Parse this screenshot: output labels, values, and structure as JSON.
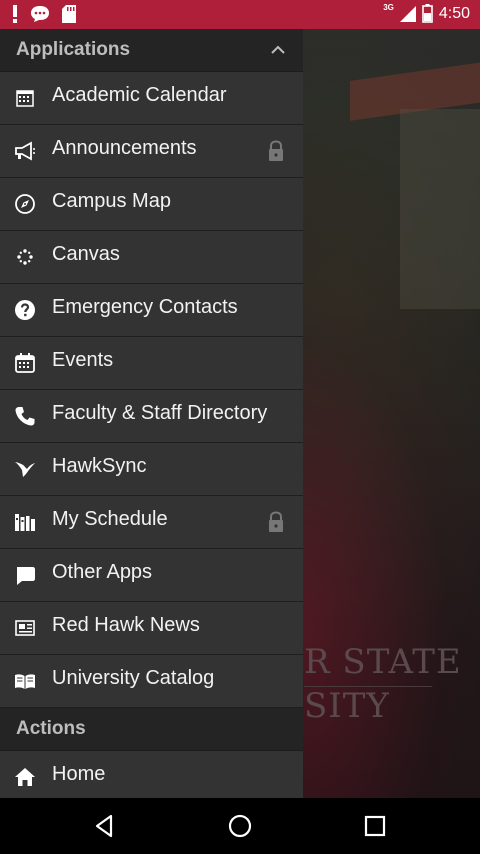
{
  "status_bar": {
    "network": "3G",
    "time": "4:50",
    "color": "#b01f3a"
  },
  "background": {
    "text_line1": "R STATE",
    "text_line2": "SITY"
  },
  "applications": {
    "title": "Applications",
    "items": [
      {
        "label": "Academic Calendar",
        "icon": "calendar-grid-icon",
        "locked": false
      },
      {
        "label": "Announcements",
        "icon": "megaphone-icon",
        "locked": true
      },
      {
        "label": "Campus Map",
        "icon": "compass-icon",
        "locked": false
      },
      {
        "label": "Canvas",
        "icon": "canvas-logo-icon",
        "locked": false
      },
      {
        "label": "Emergency Contacts",
        "icon": "help-circle-icon",
        "locked": false
      },
      {
        "label": "Events",
        "icon": "calendar-icon",
        "locked": false
      },
      {
        "label": "Faculty & Staff Directory",
        "icon": "phone-icon",
        "locked": false
      },
      {
        "label": "HawkSync",
        "icon": "hawk-icon",
        "locked": false
      },
      {
        "label": "My Schedule",
        "icon": "books-icon",
        "locked": true
      },
      {
        "label": "Other Apps",
        "icon": "chat-bubble-icon",
        "locked": false
      },
      {
        "label": "Red Hawk News",
        "icon": "newspaper-icon",
        "locked": false
      },
      {
        "label": "University Catalog",
        "icon": "open-book-icon",
        "locked": false
      }
    ]
  },
  "actions": {
    "title": "Actions",
    "items": [
      {
        "label": "Home",
        "icon": "home-icon"
      }
    ]
  }
}
